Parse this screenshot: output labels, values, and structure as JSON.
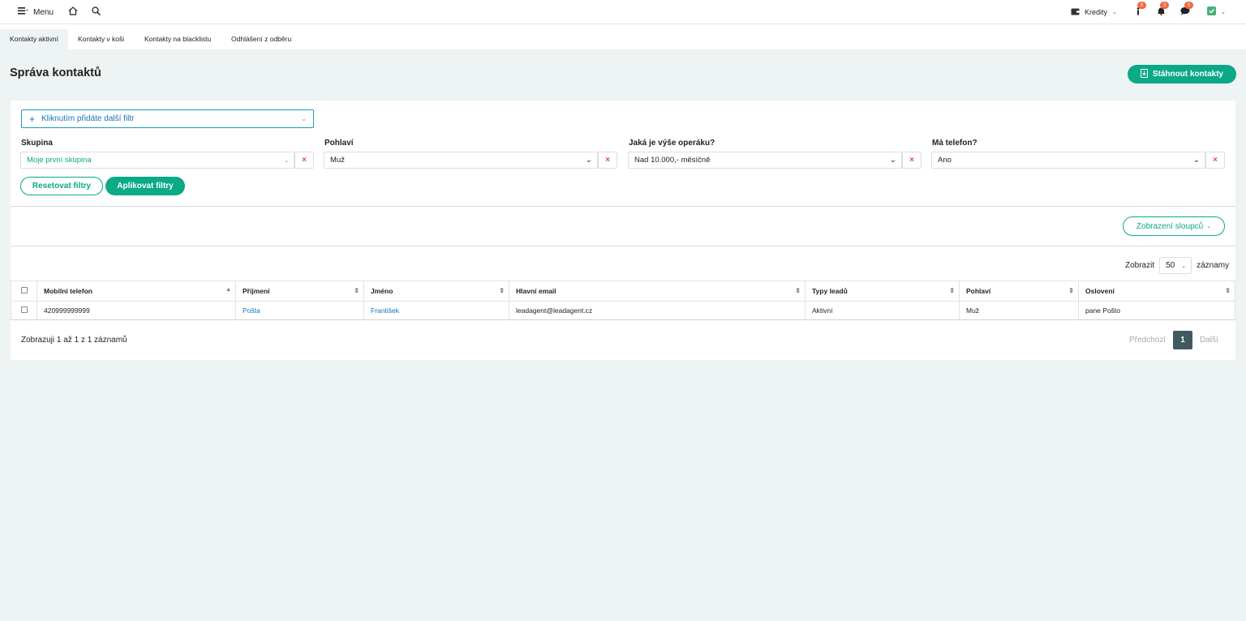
{
  "topbar": {
    "menu_label": "Menu",
    "kredity_label": "Kredity",
    "badges": {
      "info": "0",
      "bell": "3",
      "chat": "0"
    }
  },
  "tabs": [
    {
      "label": "Kontakty aktivní",
      "active": true
    },
    {
      "label": "Kontakty v koši",
      "active": false
    },
    {
      "label": "Kontakty na blacklistu",
      "active": false
    },
    {
      "label": "Odhlášení z odběru",
      "active": false
    }
  ],
  "page": {
    "title": "Správa kontaktů",
    "download_label": "Stáhnout kontakty"
  },
  "filters": {
    "add_filter_label": "Kliknutím přidáte další filtr",
    "items": [
      {
        "label": "Skupina",
        "value": "Moje první skupina"
      },
      {
        "label": "Pohlaví",
        "value": "Muž"
      },
      {
        "label": "Jaká je výše operáku?",
        "value": "Nad 10.000,- měsíčně"
      },
      {
        "label": "Má telefon?",
        "value": "Ano"
      }
    ],
    "clear_glyph": "×",
    "reset_label": "Resetovat filtry",
    "apply_label": "Aplikovat filtry"
  },
  "columns_button_label": "Zobrazení sloupců",
  "page_size": {
    "prefix": "Zobrazit",
    "value": "50",
    "suffix": "záznamy"
  },
  "table": {
    "headers": [
      "Mobilní telefon",
      "Příjmení",
      "Jméno",
      "Hlavní email",
      "Typy leadů",
      "Pohlaví",
      "Oslovení"
    ],
    "rows": [
      [
        "420999999999",
        "Pošta",
        "František",
        "leadagent@leadagent.cz",
        "Aktivní",
        "Muž",
        "pane Pošto"
      ]
    ]
  },
  "footer": {
    "info": "Zobrazuji 1 až 1 z 1 záznamů",
    "prev_label": "Předchozí",
    "current_page": "1",
    "next_label": "Další"
  },
  "colors": {
    "accent": "#0aa987",
    "link": "#1573b8",
    "badge": "#ee6a44"
  }
}
